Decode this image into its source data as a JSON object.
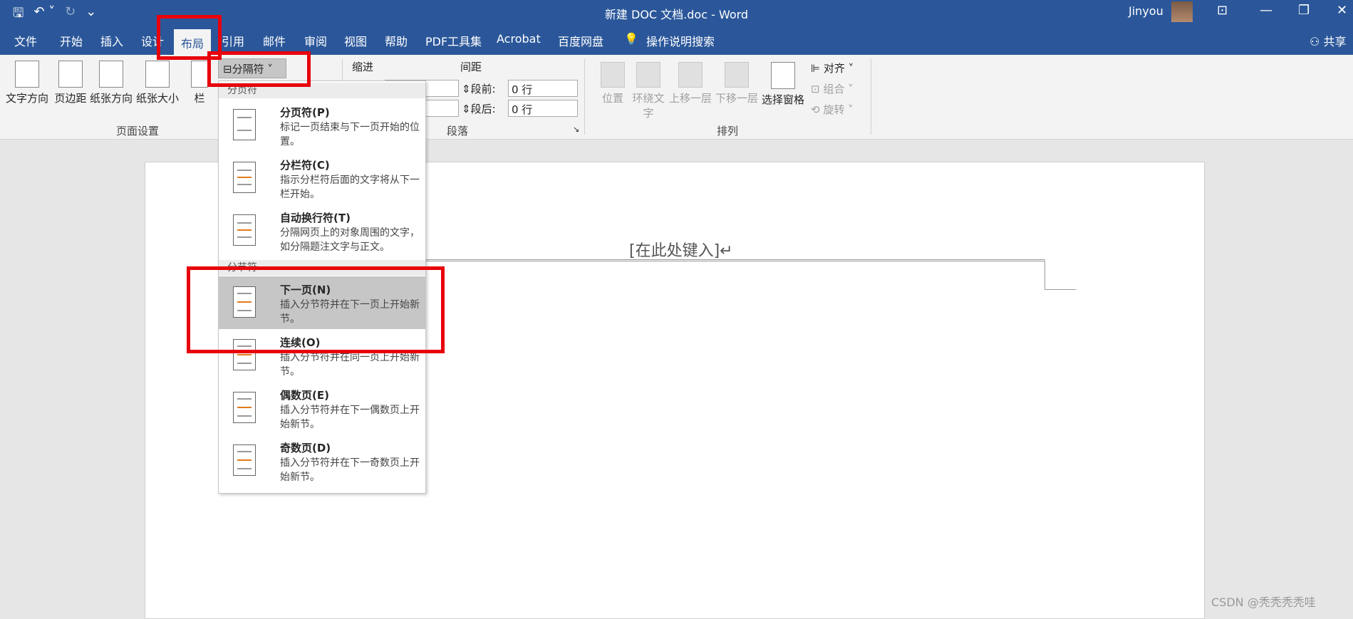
{
  "titlebar": {
    "title": "新建 DOC 文档.doc - Word",
    "user": "Jinyou",
    "min": "—",
    "restore": "❐",
    "close": "✕",
    "ribbon_toggle": "⊡"
  },
  "qat": {
    "save": "🖫",
    "undo": "↶ ˅",
    "redo": "↻",
    "more": "⌄"
  },
  "tabs": [
    "文件",
    "开始",
    "插入",
    "设计",
    "布局",
    "引用",
    "邮件",
    "审阅",
    "视图",
    "帮助",
    "PDF工具集",
    "Acrobat",
    "百度网盘",
    "操作说明搜索"
  ],
  "share": "共享",
  "ribbon": {
    "page_setup": {
      "label": "页面设置",
      "text_direction": "文字方向",
      "margins": "页边距",
      "orientation": "纸张方向",
      "size": "纸张大小",
      "columns": "栏"
    },
    "breaks_button": "分隔符 ˅",
    "indent": {
      "label": "缩进"
    },
    "spacing": {
      "label": "间距",
      "before_label": "段前:",
      "before_value": "0 行",
      "after_label": "段后:",
      "after_value": "0 行"
    },
    "paragraph_label": "段落",
    "arrange": {
      "label": "排列",
      "position": "位置",
      "wrap_text": "环绕文字",
      "bring_forward": "上移一层",
      "send_backward": "下移一层",
      "selection_pane": "选择窗格",
      "align": "对齐 ˅",
      "group": "组合 ˅",
      "rotate": "旋转 ˅"
    }
  },
  "menu": {
    "page_breaks_header": "分页符",
    "section_breaks_header": "分节符",
    "items": [
      {
        "title": "分页符(P)",
        "desc": "标记一页结束与下一页开始的位置。"
      },
      {
        "title": "分栏符(C)",
        "desc": "指示分栏符后面的文字将从下一栏开始。"
      },
      {
        "title": "自动换行符(T)",
        "desc": "分隔网页上的对象周围的文字，如分隔题注文字与正文。"
      },
      {
        "title": "下一页(N)",
        "desc": "插入分节符并在下一页上开始新节。"
      },
      {
        "title": "连续(O)",
        "desc": "插入分节符并在同一页上开始新节。"
      },
      {
        "title": "偶数页(E)",
        "desc": "插入分节符并在下一偶数页上开始新节。"
      },
      {
        "title": "奇数页(D)",
        "desc": "插入分节符并在下一奇数页上开始新节。"
      }
    ]
  },
  "document": {
    "header_placeholder": "[在此处键入]↵"
  },
  "watermark": "CSDN @秃秃秃秃哇"
}
